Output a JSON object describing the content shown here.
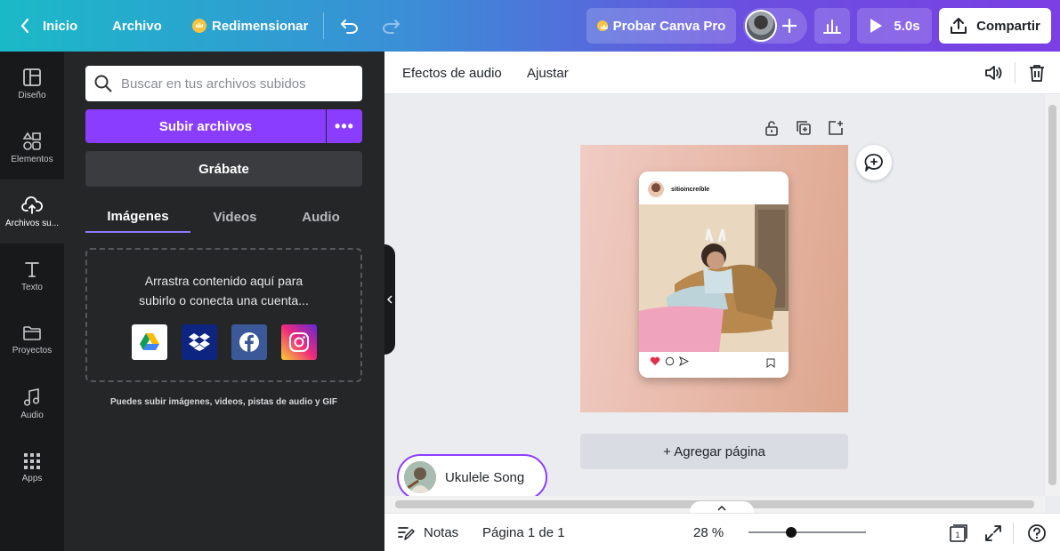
{
  "topbar": {
    "home_label": "Inicio",
    "file_label": "Archivo",
    "resize_label": "Redimensionar",
    "try_pro_label": "Probar Canva Pro",
    "duration_label": "5.0s",
    "share_label": "Compartir",
    "accent_gradient": [
      "#1bb9c8",
      "#7b3fe4"
    ]
  },
  "rail": {
    "items": [
      {
        "label": "Diseño",
        "icon": "layout-icon"
      },
      {
        "label": "Elementos",
        "icon": "shapes-icon"
      },
      {
        "label": "Archivos su...",
        "icon": "cloud-upload-icon"
      },
      {
        "label": "Texto",
        "icon": "text-icon"
      },
      {
        "label": "Proyectos",
        "icon": "folder-icon"
      },
      {
        "label": "Audio",
        "icon": "music-note-icon"
      },
      {
        "label": "Apps",
        "icon": "apps-grid-icon"
      }
    ]
  },
  "panel": {
    "search_placeholder": "Buscar en tus archivos subidos",
    "upload_label": "Subir archivos",
    "more_label": "•••",
    "record_label": "Grábate",
    "tabs": [
      {
        "label": "Imágenes"
      },
      {
        "label": "Videos"
      },
      {
        "label": "Audio"
      }
    ],
    "dropzone_text_1": "Arrastra contenido aquí para",
    "dropzone_text_2": "subirlo o conecta una cuenta...",
    "hint": "Puedes subir imágenes, videos, pistas de audio y GIF"
  },
  "editor": {
    "audio_effects_label": "Efectos de audio",
    "adjust_label": "Ajustar",
    "post_username": "sitioincreíble",
    "add_page_label": "+ Agregar página",
    "audio_track_label": "Ukulele Song",
    "brand_purple": "#8b3dff"
  },
  "footer": {
    "notes_label": "Notas",
    "page_label": "Página 1 de 1",
    "zoom_label": "28 %",
    "zoom_level": 0.36,
    "page_count_badge": "1"
  }
}
